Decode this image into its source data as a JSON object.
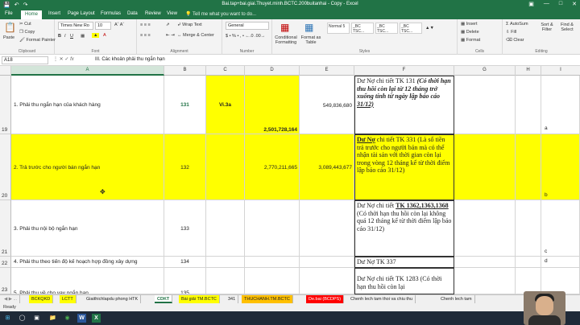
{
  "window": {
    "title": "Bai.tap+bai.giai.Thuyet.minh.BCTC.200buitanhai - Copy - Excel",
    "tabs": [
      "File",
      "Home",
      "Insert",
      "Page Layout",
      "Formulas",
      "Data",
      "Review",
      "View"
    ],
    "tell_me": "Tell me what you want to do..."
  },
  "ribbon": {
    "paste": "Paste",
    "cut": "Cut",
    "copy": "Copy",
    "format_painter": "Format Painter",
    "clipboard": "Clipboard",
    "font_name": "Times New Ro",
    "font_size": "10",
    "font": "Font",
    "wrap_text": "Wrap Text",
    "merge_center": "Merge & Center",
    "alignment": "Alignment",
    "number_format": "General",
    "number": "Number",
    "conditional_formatting": "Conditional Formatting",
    "format_as_table": "Format as Table",
    "styles_label": "Styles",
    "style_items": [
      "Normal 5",
      "_BC TSC...",
      "_BC TSC...",
      "_BC TSC..."
    ],
    "insert": "Insert",
    "delete": "Delete",
    "format": "Format",
    "cells": "Cells",
    "autosum": "AutoSum",
    "fill": "Fill",
    "clear": "Clear",
    "sort_filter": "Sort & Filter",
    "find_select": "Find & Select",
    "editing": "Editing"
  },
  "formula_bar": {
    "name_box": "A18",
    "content": "III. Các khoản phải thu ngắn hạn"
  },
  "columns": [
    "A",
    "B",
    "C",
    "D",
    "E",
    "F",
    "G",
    "H",
    "I"
  ],
  "rows": [
    {
      "num": "19",
      "a": "1. Phải thu ngắn hạn của khách hàng",
      "b": "131",
      "c": "Vi.3a",
      "d": "2,501,728,164",
      "e": "549,836,680",
      "f_plain": "Dư Nợ chi tiết TK 131 ",
      "f_italic": "(Có thời hạn thu hồi còn lại từ 12 tháng trở xuống tính từ ngày lập báo cáo ",
      "f_underline": "31/12)",
      "i": "a"
    },
    {
      "num": "20",
      "a": "2. Trả trước cho người bán ngắn hạn",
      "b": "132",
      "d": "2,770,211,665",
      "e": "3,089,443,677",
      "f_underline": "Dư Nợ",
      "f_plain": " chi tiết TK 331 (Là số tiền trả trước cho người bán mà có thể nhận tài sản với thời gian còn lại trong vòng 12 tháng kể từ thời điểm lập báo cáo 31/12)",
      "i": "b"
    },
    {
      "num": "21",
      "a": "3. Phải thu nội bộ ngắn hạn",
      "b": "133",
      "f_plain": "Dư Nợ chi tiết ",
      "f_underline": "TK 1362,1363,1368",
      "f_rest": " (Có thời hạn thu hồi còn lại không quá 12 tháng kể từ thời điểm lập báo cáo 31/12)",
      "i": "c"
    },
    {
      "num": "22",
      "a": "4. Phải thu theo tiến độ kế hoạch hợp đồng xây dựng",
      "b": "134",
      "f_plain": "Dư Nợ TK 337",
      "i": "d"
    },
    {
      "num": "23",
      "a": "5. Phải thu về cho vay ngắn hạn",
      "b": "135",
      "f_plain": "Dư Nợ chi tiết TK 1283 (Có thời hạn thu hồi còn lại"
    }
  ],
  "sheet_tabs": [
    {
      "label": "BCKQKD",
      "color": "#ffff00"
    },
    {
      "label": "LCTT",
      "color": "#ffff00"
    },
    {
      "label": "Giaithichlapdu phong HTK",
      "color": "#f0f0f0"
    },
    {
      "label": "CDKT",
      "color": "#ffffff"
    },
    {
      "label": "Bài giải TM.BCTC",
      "color": "#ffff00"
    },
    {
      "label": "341",
      "color": "#f0f0f0"
    },
    {
      "label": "THUCHANH.TM.BCTC",
      "color": "#ffc000"
    },
    {
      "label": "De.bai (BCDPS)",
      "color": "#ff0000"
    },
    {
      "label": "Chenh lech tam thoi va chiu thu",
      "color": "#f0f0f0"
    },
    {
      "label": "Chenh lech tam",
      "color": "#f0f0f0"
    }
  ],
  "status": "Ready"
}
